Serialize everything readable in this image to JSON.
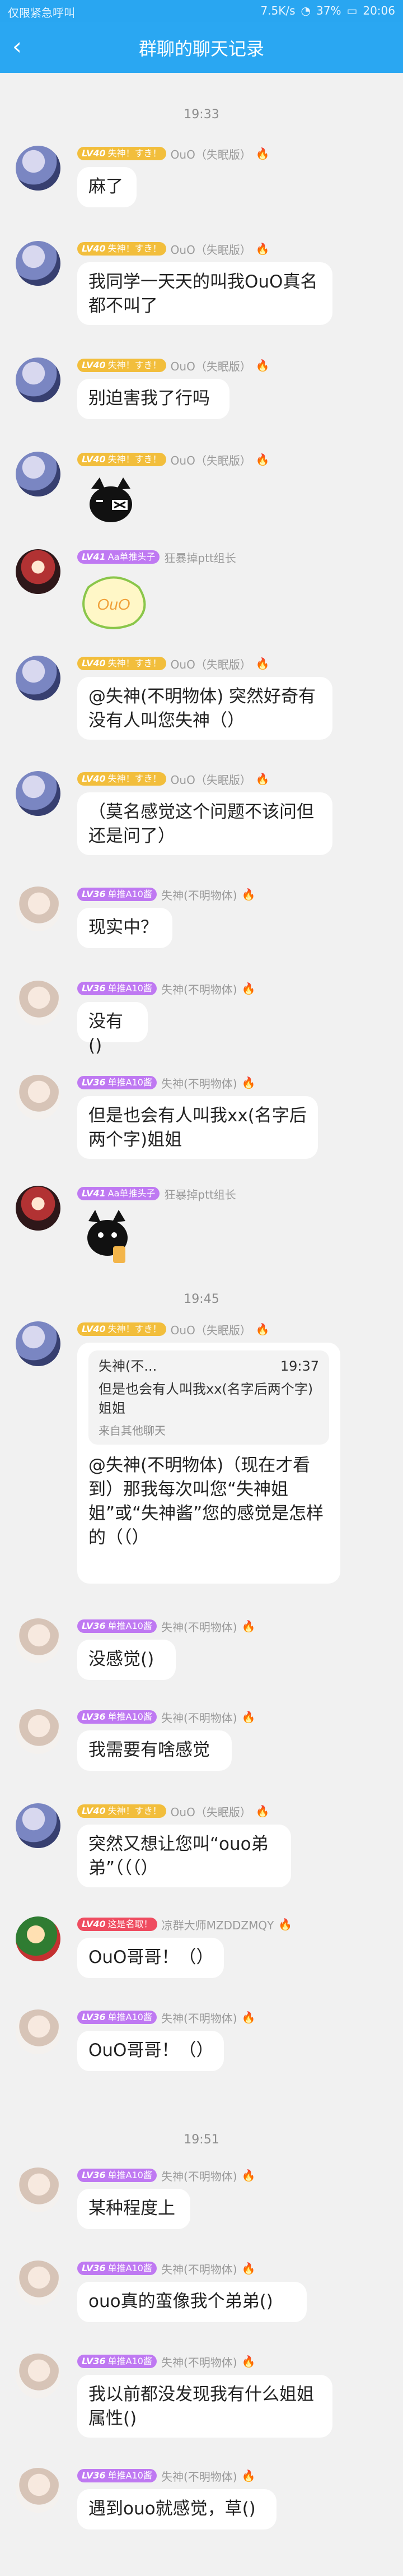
{
  "status_bar": {
    "left": "仅限紧急呼叫",
    "speed": "7.5K/s",
    "battery": "37%",
    "time": "20:06"
  },
  "header": {
    "title": "群聊的聊天记录",
    "back_icon": "‹"
  },
  "times": [
    "19:33",
    "19:45",
    "19:51"
  ],
  "badges": {
    "lv40": {
      "level": "LV40",
      "title": "失神！すき！"
    },
    "lv41": {
      "level": "LV41",
      "title": "Aa单推头子"
    },
    "lv36": {
      "level": "LV36",
      "title": "单推A10酱"
    },
    "lv40red": {
      "level": "LV40",
      "title": "这是名取！"
    }
  },
  "names": {
    "ouo": "OuO（失眠版）",
    "kb": "狂暴掉ptt组长",
    "ss": "失神(不明物体)",
    "lq": "凉群大师MZDDZMQY"
  },
  "messages": [
    {
      "id": "m1",
      "text": "麻了"
    },
    {
      "id": "m2",
      "text": "我同学一天天的叫我OuO真名都不叫了"
    },
    {
      "id": "m3",
      "text": "别迫害我了行吗"
    },
    {
      "id": "m4",
      "sticker": "cat-sticker"
    },
    {
      "id": "m5",
      "sticker": "ouo-sticker",
      "sticker_text": "OuO"
    },
    {
      "id": "m6",
      "text": "@失神(不明物体) 突然好奇有没有人叫您失神（）"
    },
    {
      "id": "m7",
      "text": "（莫名感觉这个问题不该问但还是问了）"
    },
    {
      "id": "m8",
      "text": "现实中？"
    },
    {
      "id": "m9",
      "text": "没有()"
    },
    {
      "id": "m10",
      "text": "但是也会有人叫我xx(名字后两个字)姐姐"
    },
    {
      "id": "m11",
      "sticker": "cat-drink-sticker"
    },
    {
      "id": "m12",
      "reply": {
        "name": "失神(不...",
        "time": "19:37",
        "text": "但是也会有人叫我xx(名字后两个字)姐姐",
        "source": "来自其他聊天"
      },
      "text": "@失神(不明物体)（现在才看到）那我每次叫您“失神姐姐”或“失神酱”您的感觉是怎样的（（）"
    },
    {
      "id": "m13",
      "text": "没感觉()"
    },
    {
      "id": "m14",
      "text": "我需要有啥感觉"
    },
    {
      "id": "m15",
      "text": "突然又想让您叫“ouo弟弟”（（（）"
    },
    {
      "id": "m16",
      "text": "OuO哥哥！（）"
    },
    {
      "id": "m17",
      "text": "OuO哥哥！（）"
    },
    {
      "id": "m18",
      "text": "某种程度上"
    },
    {
      "id": "m19",
      "text": "ouo真的蛮像我个弟弟()"
    },
    {
      "id": "m20",
      "text": "我以前都没发现我有什么姐姐属性()"
    },
    {
      "id": "m21",
      "text": "遇到ouo就感觉，草()"
    }
  ]
}
